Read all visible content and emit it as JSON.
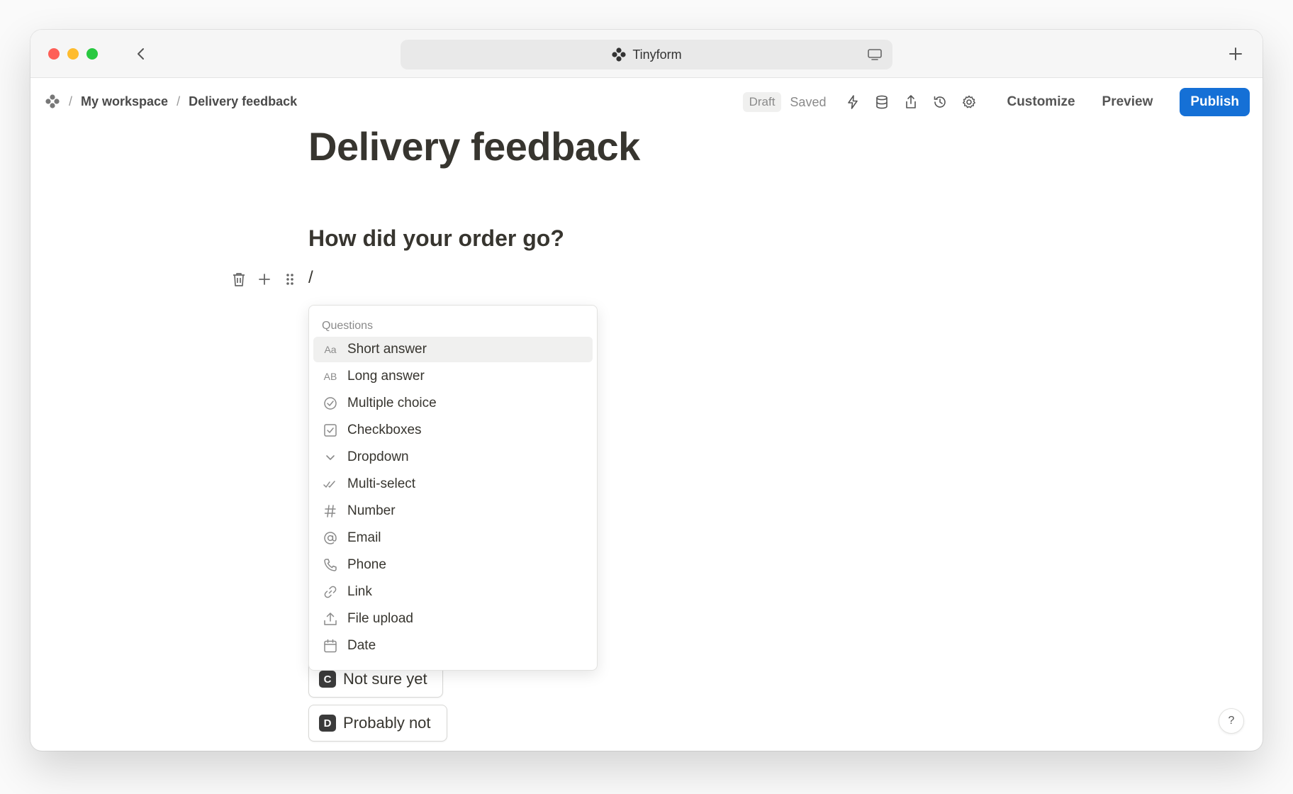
{
  "browser": {
    "tab_title": "Tinyform",
    "icons": [
      "back-chevron-icon",
      "flower-logo-icon",
      "screen-icon",
      "plus-icon"
    ]
  },
  "breadcrumb": {
    "items": [
      "My workspace",
      "Delivery feedback"
    ],
    "separator": "/"
  },
  "toolbar": {
    "draft_label": "Draft",
    "saved_label": "Saved",
    "customize_label": "Customize",
    "preview_label": "Preview",
    "publish_label": "Publish",
    "icons": [
      "lightning-icon",
      "database-icon",
      "share-icon",
      "history-icon",
      "settings-icon"
    ]
  },
  "form": {
    "title": "Delivery feedback",
    "question": "How did your order go?",
    "slash_text": "/",
    "options": [
      {
        "key": "C",
        "label": "Not sure yet"
      },
      {
        "key": "D",
        "label": "Probably not"
      }
    ]
  },
  "menu": {
    "header": "Questions",
    "items": [
      {
        "icon": "Aa",
        "label": "Short answer"
      },
      {
        "icon": "AB",
        "label": "Long answer"
      },
      {
        "icon": "check-circle-icon",
        "label": "Multiple choice"
      },
      {
        "icon": "checkbox-icon",
        "label": "Checkboxes"
      },
      {
        "icon": "chevron-down-icon",
        "label": "Dropdown"
      },
      {
        "icon": "double-check-icon",
        "label": "Multi-select"
      },
      {
        "icon": "hash-icon",
        "label": "Number"
      },
      {
        "icon": "at-icon",
        "label": "Email"
      },
      {
        "icon": "phone-icon",
        "label": "Phone"
      },
      {
        "icon": "link-icon",
        "label": "Link"
      },
      {
        "icon": "upload-icon",
        "label": "File upload"
      },
      {
        "icon": "calendar-icon",
        "label": "Date"
      }
    ]
  },
  "help": {
    "label": "?"
  },
  "colors": {
    "accent": "#1570d6",
    "text": "#37352f",
    "muted": "#8a8a8a"
  }
}
